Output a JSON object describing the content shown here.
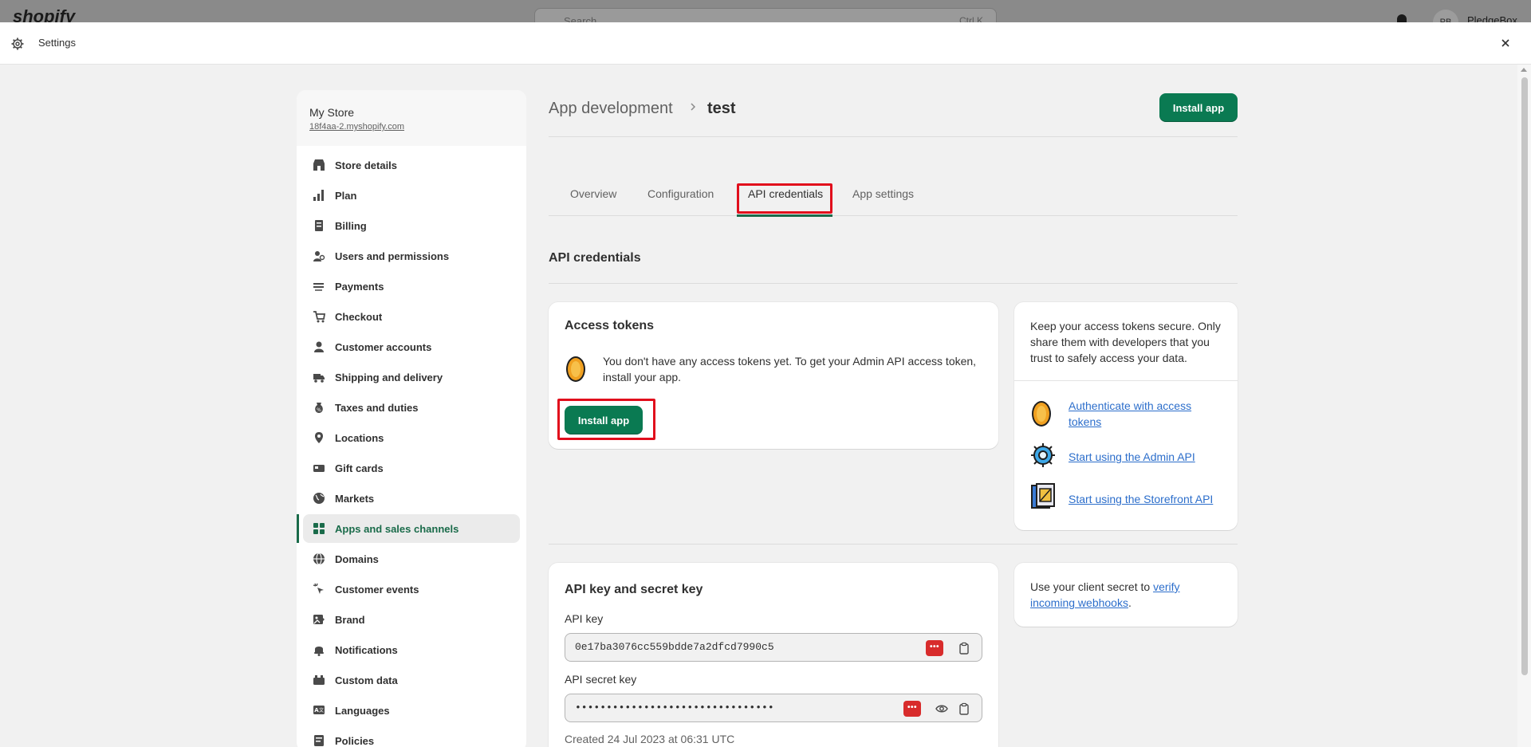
{
  "background": {
    "logo_text": "shopify",
    "search_placeholder": "Search",
    "search_shortcut": "Ctrl K",
    "avatar_initials": "PB",
    "user_name": "PledgeBox"
  },
  "modal": {
    "title": "Settings"
  },
  "sidebar": {
    "store_name": "My Store",
    "store_url": "18f4aa-2.myshopify.com",
    "items": [
      {
        "label": "Store details",
        "icon": "store-icon"
      },
      {
        "label": "Plan",
        "icon": "plan-icon"
      },
      {
        "label": "Billing",
        "icon": "billing-icon"
      },
      {
        "label": "Users and permissions",
        "icon": "users-icon"
      },
      {
        "label": "Payments",
        "icon": "payments-icon"
      },
      {
        "label": "Checkout",
        "icon": "cart-icon"
      },
      {
        "label": "Customer accounts",
        "icon": "person-icon"
      },
      {
        "label": "Shipping and delivery",
        "icon": "truck-icon"
      },
      {
        "label": "Taxes and duties",
        "icon": "tax-icon"
      },
      {
        "label": "Locations",
        "icon": "location-icon"
      },
      {
        "label": "Gift cards",
        "icon": "gift-card-icon"
      },
      {
        "label": "Markets",
        "icon": "globe-icon"
      },
      {
        "label": "Apps and sales channels",
        "icon": "apps-icon",
        "active": true
      },
      {
        "label": "Domains",
        "icon": "domain-icon"
      },
      {
        "label": "Customer events",
        "icon": "cursor-icon"
      },
      {
        "label": "Brand",
        "icon": "brand-icon"
      },
      {
        "label": "Notifications",
        "icon": "bell-icon"
      },
      {
        "label": "Custom data",
        "icon": "custom-data-icon"
      },
      {
        "label": "Languages",
        "icon": "language-icon"
      },
      {
        "label": "Policies",
        "icon": "policy-icon"
      }
    ]
  },
  "header": {
    "breadcrumb_parent": "App development",
    "breadcrumb_current": "test",
    "install_label": "Install app"
  },
  "tabs": [
    {
      "label": "Overview"
    },
    {
      "label": "Configuration"
    },
    {
      "label": "API credentials",
      "active": true
    },
    {
      "label": "App settings"
    }
  ],
  "section_title": "API credentials",
  "access_tokens": {
    "title": "Access tokens",
    "message": "You don't have any access tokens yet. To get your Admin API access token, install your app.",
    "install_label": "Install app"
  },
  "security_card": {
    "text": "Keep your access tokens secure. Only share them with developers that you trust to safely access your data.",
    "links": [
      {
        "label": "Authenticate with access tokens",
        "icon": "coin-icon"
      },
      {
        "label": "Start using the Admin API",
        "icon": "gear-icon"
      },
      {
        "label": "Start using the Storefront API",
        "icon": "storefront-icon"
      }
    ]
  },
  "api_keys": {
    "title": "API key and secret key",
    "api_key_label": "API key",
    "api_key_value": "0e17ba3076cc559bdde7a2dfcd7990c5",
    "secret_label": "API secret key",
    "secret_value": "••••••••••••••••••••••••••••••••",
    "created": "Created 24 Jul 2023 at 06:31 UTC",
    "password_badge": "•••"
  },
  "webhook_card": {
    "prefix": "Use your client secret to ",
    "link": "verify incoming webhooks",
    "suffix": "."
  },
  "colors": {
    "primary": "#0a7a52",
    "active_nav": "#1a6b4a",
    "highlight": "#e10e1c",
    "link": "#2c6ecb"
  }
}
